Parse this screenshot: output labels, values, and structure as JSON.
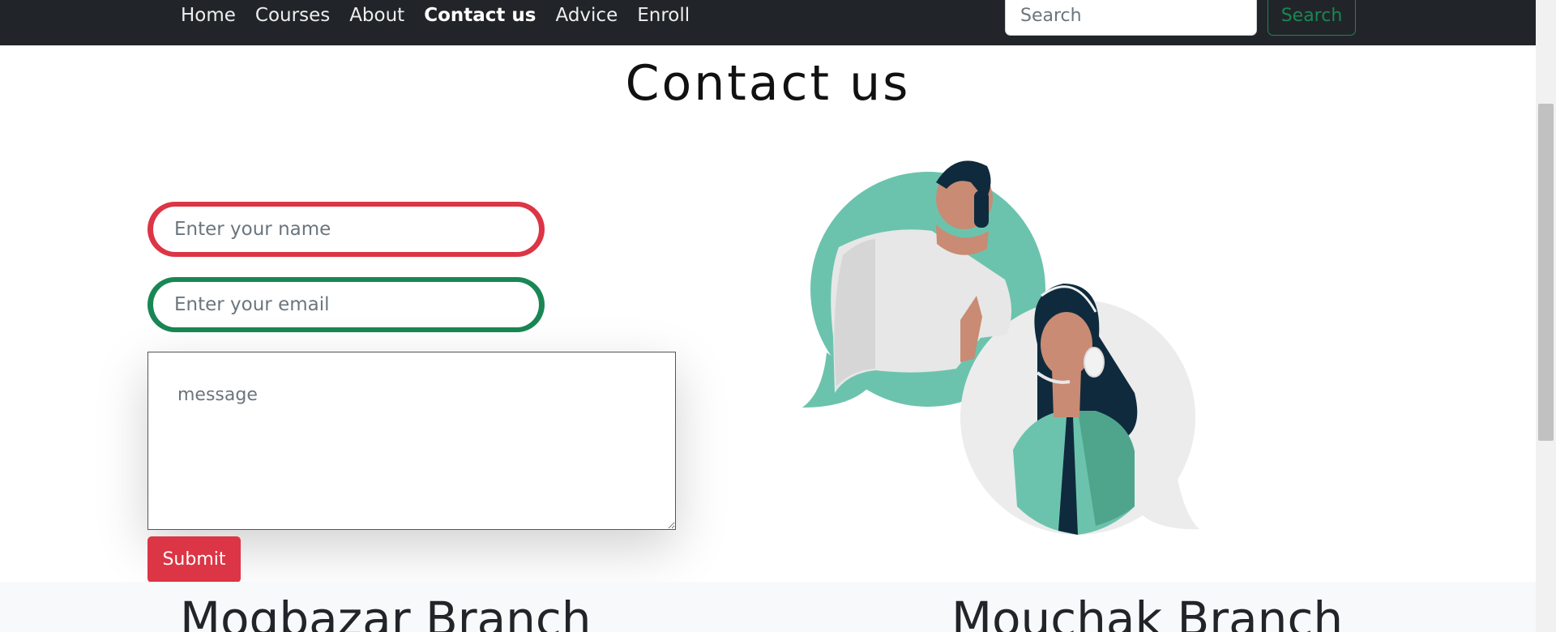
{
  "nav": {
    "items": [
      {
        "label": "Home",
        "active": false
      },
      {
        "label": "Courses",
        "active": false
      },
      {
        "label": "About",
        "active": false
      },
      {
        "label": "Contact us",
        "active": true
      },
      {
        "label": "Advice",
        "active": false
      },
      {
        "label": "Enroll",
        "active": false
      }
    ],
    "search_placeholder": "Search",
    "search_button": "Search"
  },
  "page": {
    "title": "Contact us"
  },
  "form": {
    "name_placeholder": "Enter your name",
    "email_placeholder": "Enter your email",
    "message_placeholder": "message",
    "submit_label": "Submit"
  },
  "branches": {
    "left": "Mogbazar Branch",
    "right": "Mouchak Branch"
  },
  "colors": {
    "navbar": "#212529",
    "danger": "#dc3545",
    "success": "#198754",
    "illustration_teal": "#6cc3ad",
    "illustration_dark": "#0f2a3d"
  },
  "icons": {
    "illustration": "customer-support-illustration"
  }
}
